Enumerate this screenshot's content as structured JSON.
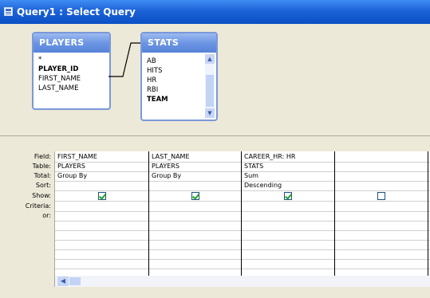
{
  "window": {
    "title": "Query1 : Select Query"
  },
  "tables": [
    {
      "name": "PLAYERS",
      "fields": [
        {
          "label": "*",
          "bold": false
        },
        {
          "label": "PLAYER_ID",
          "bold": true
        },
        {
          "label": "FIRST_NAME",
          "bold": false
        },
        {
          "label": "LAST_NAME",
          "bold": false
        }
      ]
    },
    {
      "name": "STATS",
      "fields": [
        {
          "label": "AB",
          "bold": false
        },
        {
          "label": "HITS",
          "bold": false
        },
        {
          "label": "HR",
          "bold": false
        },
        {
          "label": "RBI",
          "bold": false
        },
        {
          "label": "TEAM",
          "bold": true
        }
      ]
    }
  ],
  "grid": {
    "row_labels": [
      "Field:",
      "Table:",
      "Total:",
      "Sort:",
      "Show:",
      "Criteria:",
      "or:"
    ],
    "columns": [
      {
        "field": "FIRST_NAME",
        "table": "PLAYERS",
        "total": "Group By",
        "sort": "",
        "show": true
      },
      {
        "field": "LAST_NAME",
        "table": "PLAYERS",
        "total": "Group By",
        "sort": "",
        "show": true
      },
      {
        "field": "CAREER_HR: HR",
        "table": "STATS",
        "total": "Sum",
        "sort": "Descending",
        "show": true
      },
      {
        "field": "",
        "table": "",
        "total": "",
        "sort": "",
        "show": false
      }
    ]
  },
  "icons": {
    "title": "query-icon",
    "scroll_up": "arrow-up-icon",
    "scroll_down": "arrow-down-icon",
    "scroll_left": "arrow-left-icon"
  },
  "colors": {
    "titlebar": "#1d63d8",
    "table_header": "#6c95e4",
    "checkmark": "#21a121",
    "workspace": "#ece9d8"
  }
}
